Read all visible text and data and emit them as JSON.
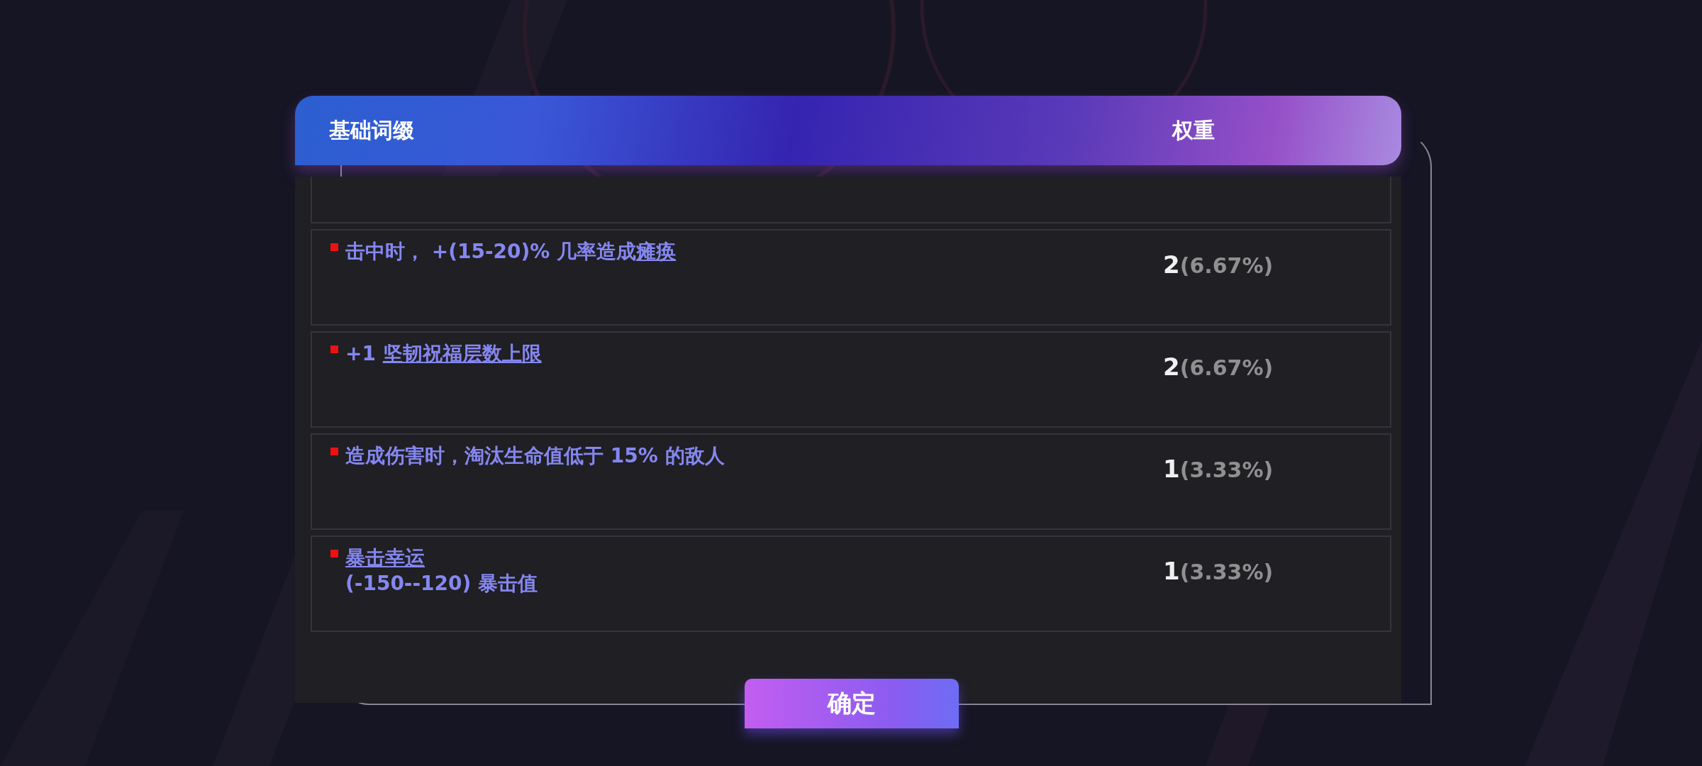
{
  "table": {
    "columns": [
      "基础词缀",
      "权重"
    ],
    "rows": [
      {
        "parts": [
          {
            "kind": "text",
            "text": "击中时， +(15-20)% 几率造成"
          },
          {
            "kind": "link",
            "text": "瘫痪"
          }
        ],
        "weight": "2",
        "share": "(6.67%)"
      },
      {
        "parts": [
          {
            "kind": "text",
            "text": "+1 "
          },
          {
            "kind": "link",
            "text": "坚韧祝福层数上限"
          }
        ],
        "weight": "2",
        "share": "(6.67%)"
      },
      {
        "parts": [
          {
            "kind": "text",
            "text": "造成伤害时，淘汰生命值低于 15% 的敌人"
          }
        ],
        "weight": "1",
        "share": "(3.33%)"
      },
      {
        "parts": [
          {
            "kind": "link",
            "text": "暴击幸运"
          },
          {
            "kind": "break"
          },
          {
            "kind": "text",
            "text": "(-150--120) 暴击值"
          }
        ],
        "weight": "1",
        "share": "(3.33%)"
      }
    ]
  },
  "confirm_button": "确定"
}
